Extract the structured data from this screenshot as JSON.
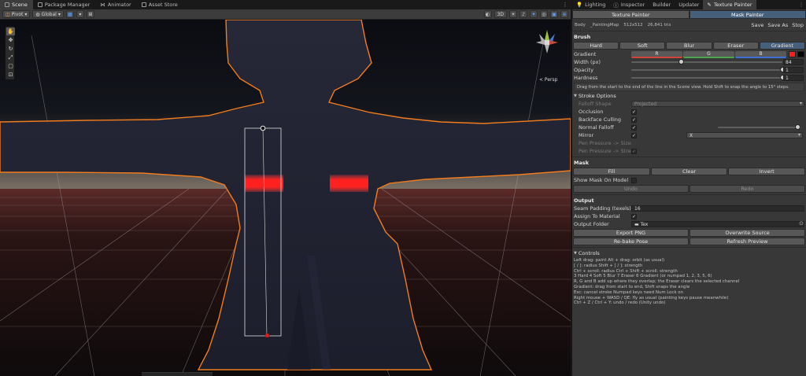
{
  "scene_tabs": [
    {
      "label": "Scene",
      "active": true
    },
    {
      "label": "Package Manager",
      "active": false
    },
    {
      "label": "Animator",
      "active": false
    },
    {
      "label": "Asset Store",
      "active": false
    }
  ],
  "scene_toolbar": {
    "pivot": "Pivot",
    "global": "Global",
    "mode_2d": "3D"
  },
  "viewport": {
    "persp_label": "< Persp",
    "selection_color": "#f07c1e",
    "paint_color": "#ff1e1e"
  },
  "right_tabs": [
    {
      "label": "Lighting",
      "active": false
    },
    {
      "label": "Inspector",
      "active": false
    },
    {
      "label": "Builder",
      "active": false
    },
    {
      "label": "Updater",
      "active": false
    },
    {
      "label": "Texture Painter",
      "active": true
    }
  ],
  "painter": {
    "mode_texture": "Texture Painter",
    "mode_mask": "Mask Painter",
    "info_object": "Body",
    "info_map": "_PaintingMap",
    "info_size": "512x512",
    "info_tris": "26,841 tris",
    "save": "Save",
    "save_as": "Save As",
    "stop": "Stop",
    "brush_title": "Brush",
    "brush_types": [
      "Hard",
      "Soft",
      "Blur",
      "Eraser",
      "Gradient"
    ],
    "active_brush": 4,
    "gradient_label": "Gradient",
    "gradient_channels": [
      "R",
      "G",
      "B"
    ],
    "gradient_colors": [
      "#ff1f1f",
      "#000000"
    ],
    "channel_colors": [
      "#d0443a",
      "#4ea44e",
      "#3f6fd6"
    ],
    "width_label": "Width (px)",
    "width_value": "84",
    "width_fraction": 0.33,
    "opacity_label": "Opacity",
    "opacity_value": "1",
    "opacity_fraction": 1.0,
    "hardness_label": "Hardness",
    "hardness_value": "1",
    "hardness_fraction": 1.0,
    "help_text": "Drag from the start to the end of the line in the Scene view. Hold Shift to snap the angle to 15° steps.",
    "stroke_title": "Stroke Options",
    "falloff_shape_label": "Falloff Shape",
    "falloff_shape_value": "Projected",
    "occlusion_label": "Occlusion",
    "backface_label": "Backface Culling",
    "normal_falloff_label": "Normal Falloff",
    "normal_falloff_fraction": 0.96,
    "mirror_label": "Mirror",
    "mirror_value": "X",
    "pen_size_label": "Pen Pressure -> Size",
    "pen_strength_label": "Pen Pressure -> Strength",
    "mask_title": "Mask",
    "mask_buttons": [
      "Fill",
      "Clear",
      "Invert"
    ],
    "show_mask_label": "Show Mask On Model",
    "undo": "Undo",
    "redo": "Redo",
    "output_title": "Output",
    "seam_label": "Seam Padding (texels)",
    "seam_value": "16",
    "assign_label": "Assign To Material",
    "folder_label": "Output Folder",
    "folder_value": "Tex",
    "export_png": "Export PNG",
    "overwrite_source": "Overwrite Source",
    "rebake_pose": "Re-bake Pose",
    "refresh_preview": "Refresh Preview",
    "controls_title": "Controls",
    "controls_lines": [
      "Left drag: paint    Alt + drag: orbit (as usual)",
      "[ / ]: radius    Shift + [ / ]: strength",
      "Ctrl + scroll: radius    Ctrl + Shift + scroll: strength",
      "3 Hard   4 Soft   5 Blur   7 Eraser   8 Gradient   (or numpad 1, 2, 3, 5, 6)",
      "R, G and B add up where they overlap; the Eraser clears the selected channel",
      "Gradient: drag from start to end, Shift snaps the angle",
      "Esc: cancel stroke    Numpad keys need Num Lock on",
      "Right mouse + WASD / QE: fly as usual (painting keys pause meanwhile)",
      "Ctrl + Z / Ctrl + Y: undo / redo (Unity undo)"
    ]
  }
}
